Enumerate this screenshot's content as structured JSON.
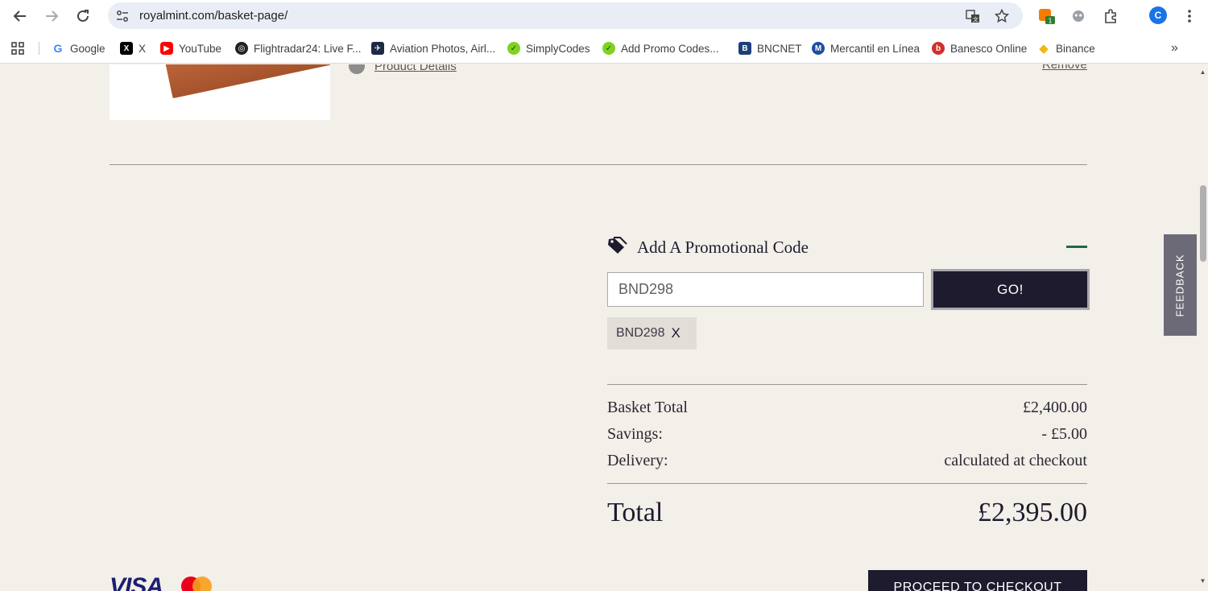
{
  "browser": {
    "url": "royalmint.com/basket-page/",
    "profile_initial": "C",
    "extension_badge": "1",
    "bookmarks": [
      {
        "label": "Google",
        "icon": "google-icon",
        "color": "#4285f4"
      },
      {
        "label": "X",
        "icon": "x-icon",
        "color": "#000000"
      },
      {
        "label": "YouTube",
        "icon": "youtube-icon",
        "color": "#ff0000"
      },
      {
        "label": "Flightradar24: Live F...",
        "icon": "flightradar-icon",
        "color": "#222222"
      },
      {
        "label": "Aviation Photos, Airl...",
        "icon": "aviation-icon",
        "color": "#1c2a44"
      },
      {
        "label": "SimplyCodes",
        "icon": "simplycodes-icon",
        "color": "#7ed321"
      },
      {
        "label": "Add Promo Codes...",
        "icon": "promo-codes-icon",
        "color": "#7ed321"
      },
      {
        "label": "BNCNET",
        "icon": "bncnet-icon",
        "color": "#1b3f7a"
      },
      {
        "label": "Mercantil en Línea",
        "icon": "mercantil-icon",
        "color": "#1d4fa0"
      },
      {
        "label": "Banesco Online",
        "icon": "banesco-icon",
        "color": "#d0302b"
      },
      {
        "label": "Binance",
        "icon": "binance-icon",
        "color": "#f0b90b"
      }
    ]
  },
  "product": {
    "details_link": "Product Details",
    "remove_link": "Remove"
  },
  "promo": {
    "title": "Add A Promotional Code",
    "input_value": "BND298",
    "go_label": "GO!",
    "applied_code": "BND298",
    "remove_code_label": "X"
  },
  "summary": {
    "basket_total_label": "Basket Total",
    "basket_total_value": "£2,400.00",
    "savings_label": "Savings:",
    "savings_value": "- £5.00",
    "delivery_label": "Delivery:",
    "delivery_value": "calculated at checkout",
    "total_label": "Total",
    "total_value": "£2,395.00"
  },
  "payment": {
    "visa_label": "VISA"
  },
  "checkout_label": "PROCEED TO CHECKOUT",
  "feedback_label": "FEEDBACK",
  "colors": {
    "page_bg": "#f3efe9",
    "brand_dark": "#1e1b2e",
    "accent_green": "#1b6a44"
  }
}
